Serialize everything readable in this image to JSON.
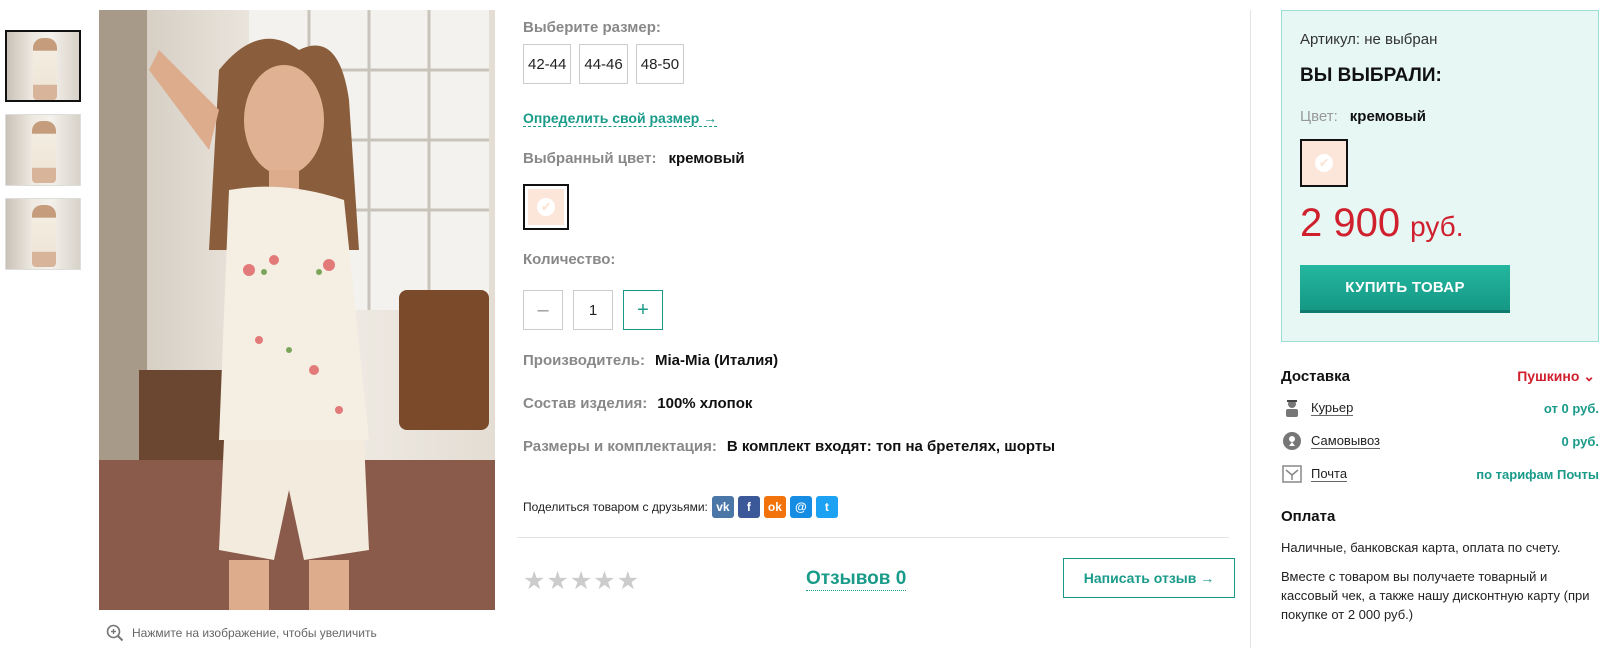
{
  "gallery": {
    "zoom_hint": "Нажмите на изображение, чтобы увеличить"
  },
  "product": {
    "size_title": "Выберите размер:",
    "sizes": [
      "42-44",
      "44-46",
      "48-50"
    ],
    "size_link": "Определить свой размер →",
    "color_label": "Выбранный цвет:",
    "color_value": "кремовый",
    "quantity_label": "Количество:",
    "quantity_value": "1",
    "minus": "–",
    "plus": "+",
    "maker_label": "Производитель:",
    "maker_value": "Mia-Mia (Италия)",
    "composition_label": "Состав изделия:",
    "composition_value": "100% хлопок",
    "set_label": "Размеры и комплектация:",
    "set_value": "В комплект входят: топ на бретелях, шорты",
    "share_label": "Поделиться товаром с друзьями:",
    "social": [
      {
        "name": "vk",
        "glyph": "vk",
        "color": "#4a76a8"
      },
      {
        "name": "facebook",
        "glyph": "f",
        "color": "#3b5998"
      },
      {
        "name": "odnoklassniki",
        "glyph": "ok",
        "color": "#f2720c"
      },
      {
        "name": "moimir",
        "glyph": "@",
        "color": "#168de2"
      },
      {
        "name": "twitter",
        "glyph": "t",
        "color": "#1da1f2"
      }
    ],
    "stars": "★★★★★",
    "reviews": "Отзывов 0",
    "write_review": "Написать отзыв →"
  },
  "order": {
    "article": "Артикул: не выбран",
    "you_chose": "ВЫ ВЫБРАЛИ:",
    "color_label": "Цвет:",
    "color_value": "кремовый",
    "price": "2 900",
    "currency": "руб.",
    "buy": "КУПИТЬ ТОВАР"
  },
  "delivery": {
    "title": "Доставка",
    "city": "Пушкино ⌄",
    "rows": [
      {
        "icon": "courier-icon",
        "name": "Курьер",
        "price": "от 0 руб."
      },
      {
        "icon": "pickup-icon",
        "name": "Самовывоз",
        "price": "0 руб."
      },
      {
        "icon": "post-icon",
        "name": "Почта",
        "price": "по тарифам Почты"
      }
    ]
  },
  "payment": {
    "title": "Оплата",
    "methods": "Наличные, банковская карта, оплата по счету.",
    "receipt": "Вместе с товаром вы получаете товарный и кассовый чек, а также нашу дисконтную карту (при покупке от 2 000 руб.)"
  },
  "colors": {
    "accent": "#1a9b8a",
    "price_red": "#d0202e",
    "swatch_cream": "#fbe6d9",
    "panel_bg": "#e6f7f4"
  }
}
